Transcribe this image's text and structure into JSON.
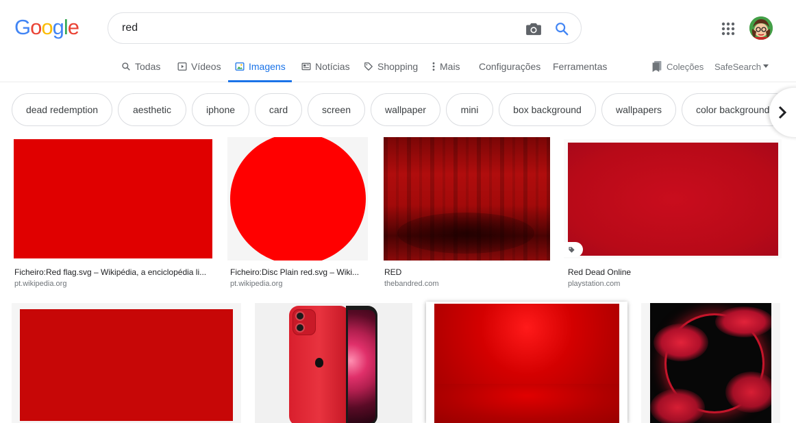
{
  "logo": {
    "letters": [
      "G",
      "o",
      "o",
      "g",
      "l",
      "e"
    ]
  },
  "search": {
    "query": "red",
    "placeholder": ""
  },
  "nav": {
    "tabs": [
      {
        "label": "Todas"
      },
      {
        "label": "Vídeos"
      },
      {
        "label": "Imagens"
      },
      {
        "label": "Notícias"
      },
      {
        "label": "Shopping"
      },
      {
        "label": "Mais"
      }
    ],
    "settings": "Configurações",
    "tools": "Ferramentas",
    "collections": "Coleções",
    "safesearch": "SafeSearch"
  },
  "chips": [
    "dead redemption",
    "aesthetic",
    "iphone",
    "card",
    "screen",
    "wallpaper",
    "mini",
    "box background",
    "wallpapers",
    "color background"
  ],
  "results": [
    {
      "title": "Ficheiro:Red flag.svg – Wikipédia, a enciclopédia li...",
      "source": "pt.wikipedia.org"
    },
    {
      "title": "Ficheiro:Disc Plain red.svg – Wiki...",
      "source": "pt.wikipedia.org"
    },
    {
      "title": "RED",
      "source": "thebandred.com"
    },
    {
      "title": "Red Dead Online",
      "source": "playstation.com"
    }
  ],
  "colors": {
    "accent": "#1a73e8",
    "red": "#e00000",
    "chip_border": "#dadce0"
  }
}
